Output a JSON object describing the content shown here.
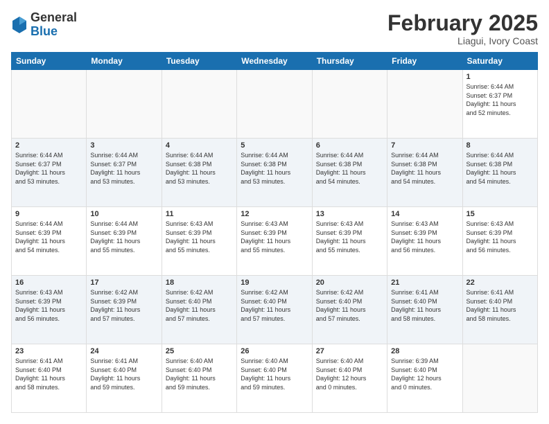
{
  "logo": {
    "general": "General",
    "blue": "Blue"
  },
  "header": {
    "month": "February 2025",
    "location": "Liagui, Ivory Coast"
  },
  "weekdays": [
    "Sunday",
    "Monday",
    "Tuesday",
    "Wednesday",
    "Thursday",
    "Friday",
    "Saturday"
  ],
  "weeks": [
    [
      {
        "day": "",
        "info": ""
      },
      {
        "day": "",
        "info": ""
      },
      {
        "day": "",
        "info": ""
      },
      {
        "day": "",
        "info": ""
      },
      {
        "day": "",
        "info": ""
      },
      {
        "day": "",
        "info": ""
      },
      {
        "day": "1",
        "info": "Sunrise: 6:44 AM\nSunset: 6:37 PM\nDaylight: 11 hours\nand 52 minutes."
      }
    ],
    [
      {
        "day": "2",
        "info": "Sunrise: 6:44 AM\nSunset: 6:37 PM\nDaylight: 11 hours\nand 53 minutes."
      },
      {
        "day": "3",
        "info": "Sunrise: 6:44 AM\nSunset: 6:37 PM\nDaylight: 11 hours\nand 53 minutes."
      },
      {
        "day": "4",
        "info": "Sunrise: 6:44 AM\nSunset: 6:38 PM\nDaylight: 11 hours\nand 53 minutes."
      },
      {
        "day": "5",
        "info": "Sunrise: 6:44 AM\nSunset: 6:38 PM\nDaylight: 11 hours\nand 53 minutes."
      },
      {
        "day": "6",
        "info": "Sunrise: 6:44 AM\nSunset: 6:38 PM\nDaylight: 11 hours\nand 54 minutes."
      },
      {
        "day": "7",
        "info": "Sunrise: 6:44 AM\nSunset: 6:38 PM\nDaylight: 11 hours\nand 54 minutes."
      },
      {
        "day": "8",
        "info": "Sunrise: 6:44 AM\nSunset: 6:38 PM\nDaylight: 11 hours\nand 54 minutes."
      }
    ],
    [
      {
        "day": "9",
        "info": "Sunrise: 6:44 AM\nSunset: 6:39 PM\nDaylight: 11 hours\nand 54 minutes."
      },
      {
        "day": "10",
        "info": "Sunrise: 6:44 AM\nSunset: 6:39 PM\nDaylight: 11 hours\nand 55 minutes."
      },
      {
        "day": "11",
        "info": "Sunrise: 6:43 AM\nSunset: 6:39 PM\nDaylight: 11 hours\nand 55 minutes."
      },
      {
        "day": "12",
        "info": "Sunrise: 6:43 AM\nSunset: 6:39 PM\nDaylight: 11 hours\nand 55 minutes."
      },
      {
        "day": "13",
        "info": "Sunrise: 6:43 AM\nSunset: 6:39 PM\nDaylight: 11 hours\nand 55 minutes."
      },
      {
        "day": "14",
        "info": "Sunrise: 6:43 AM\nSunset: 6:39 PM\nDaylight: 11 hours\nand 56 minutes."
      },
      {
        "day": "15",
        "info": "Sunrise: 6:43 AM\nSunset: 6:39 PM\nDaylight: 11 hours\nand 56 minutes."
      }
    ],
    [
      {
        "day": "16",
        "info": "Sunrise: 6:43 AM\nSunset: 6:39 PM\nDaylight: 11 hours\nand 56 minutes."
      },
      {
        "day": "17",
        "info": "Sunrise: 6:42 AM\nSunset: 6:39 PM\nDaylight: 11 hours\nand 57 minutes."
      },
      {
        "day": "18",
        "info": "Sunrise: 6:42 AM\nSunset: 6:40 PM\nDaylight: 11 hours\nand 57 minutes."
      },
      {
        "day": "19",
        "info": "Sunrise: 6:42 AM\nSunset: 6:40 PM\nDaylight: 11 hours\nand 57 minutes."
      },
      {
        "day": "20",
        "info": "Sunrise: 6:42 AM\nSunset: 6:40 PM\nDaylight: 11 hours\nand 57 minutes."
      },
      {
        "day": "21",
        "info": "Sunrise: 6:41 AM\nSunset: 6:40 PM\nDaylight: 11 hours\nand 58 minutes."
      },
      {
        "day": "22",
        "info": "Sunrise: 6:41 AM\nSunset: 6:40 PM\nDaylight: 11 hours\nand 58 minutes."
      }
    ],
    [
      {
        "day": "23",
        "info": "Sunrise: 6:41 AM\nSunset: 6:40 PM\nDaylight: 11 hours\nand 58 minutes."
      },
      {
        "day": "24",
        "info": "Sunrise: 6:41 AM\nSunset: 6:40 PM\nDaylight: 11 hours\nand 59 minutes."
      },
      {
        "day": "25",
        "info": "Sunrise: 6:40 AM\nSunset: 6:40 PM\nDaylight: 11 hours\nand 59 minutes."
      },
      {
        "day": "26",
        "info": "Sunrise: 6:40 AM\nSunset: 6:40 PM\nDaylight: 11 hours\nand 59 minutes."
      },
      {
        "day": "27",
        "info": "Sunrise: 6:40 AM\nSunset: 6:40 PM\nDaylight: 12 hours\nand 0 minutes."
      },
      {
        "day": "28",
        "info": "Sunrise: 6:39 AM\nSunset: 6:40 PM\nDaylight: 12 hours\nand 0 minutes."
      },
      {
        "day": "",
        "info": ""
      }
    ]
  ]
}
